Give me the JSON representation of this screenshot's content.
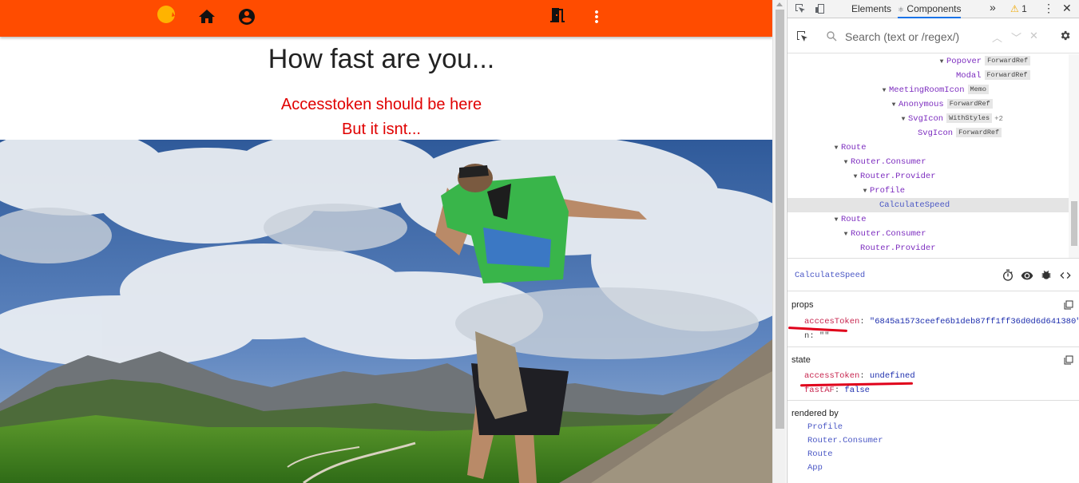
{
  "app": {
    "heading": "How fast are you...",
    "error_line1": "Accesstoken should be here",
    "error_line2": "But it isnt...",
    "colors": {
      "appbar": "#ff4c00",
      "error_text": "#e00000"
    },
    "icons": [
      "logo-icon",
      "home-icon",
      "account-circle-icon",
      "exit-door-icon",
      "more-vert-icon"
    ]
  },
  "devtools": {
    "tabs": {
      "elements": "Elements",
      "components": "Components",
      "more": "»",
      "warnings": "1"
    },
    "search": {
      "placeholder": "Search (text or /regex/)"
    },
    "tree": [
      {
        "name": "Popover",
        "badge": "ForwardRef",
        "expanded": true
      },
      {
        "name": "Modal",
        "badge": "ForwardRef"
      },
      {
        "name": "MeetingRoomIcon",
        "badge": "Memo",
        "expanded": true
      },
      {
        "name": "Anonymous",
        "badge": "ForwardRef",
        "expanded": true
      },
      {
        "name": "SvgIcon",
        "badge": "WithStyles",
        "extra": "+2",
        "expanded": true
      },
      {
        "name": "SvgIcon",
        "badge": "ForwardRef"
      },
      {
        "name": "Route",
        "expanded": true
      },
      {
        "name": "Router.Consumer",
        "expanded": true
      },
      {
        "name": "Router.Provider",
        "expanded": true
      },
      {
        "name": "Profile",
        "expanded": true
      },
      {
        "name": "CalculateSpeed",
        "selected": true
      },
      {
        "name": "Route",
        "expanded": true
      },
      {
        "name": "Router.Consumer",
        "expanded": true
      },
      {
        "name": "Router.Provider"
      }
    ],
    "selected_component": "CalculateSpeed",
    "props_title": "props",
    "props": [
      {
        "key": "acccesToken",
        "value": "\"6845a1573ceefe6b1deb87ff1ff36d0d6d641380\""
      },
      {
        "key": "n",
        "value": "\"\""
      }
    ],
    "state_title": "state",
    "state": [
      {
        "key": "accessToken",
        "value": "undefined"
      },
      {
        "key": "fastAF",
        "value": "false"
      }
    ],
    "rendered_by_title": "rendered by",
    "rendered_by": [
      "Profile",
      "Router.Consumer",
      "Route",
      "App"
    ]
  }
}
